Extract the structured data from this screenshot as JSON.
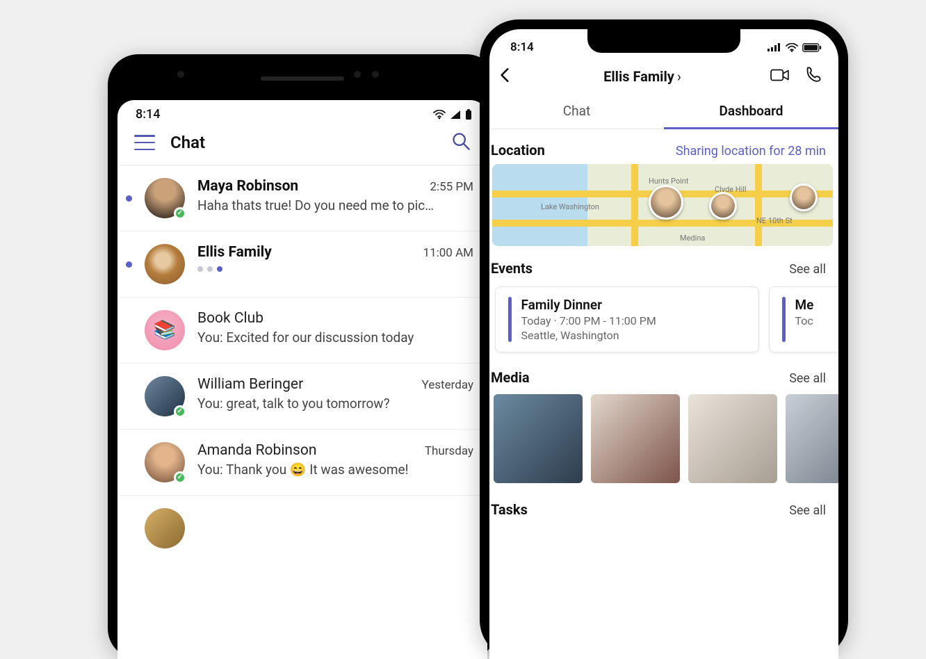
{
  "android": {
    "status_time": "8:14",
    "header_title": "Chat",
    "chats": [
      {
        "name": "Maya Robinson",
        "time": "2:55 PM",
        "preview": "Haha thats true! Do you need me to pic…",
        "unread": true,
        "presence": true,
        "avatar": "photo1"
      },
      {
        "name": "Ellis Family",
        "time": "11:00 AM",
        "preview": "",
        "typing": true,
        "unread": true,
        "presence": false,
        "avatar": "photo2"
      },
      {
        "name": "Book Club",
        "time": "",
        "preview": "You: Excited for our discussion today",
        "unread": false,
        "presence": false,
        "avatar": "pink"
      },
      {
        "name": "William Beringer",
        "time": "Yesterday",
        "preview": "You: great, talk to you tomorrow?",
        "unread": false,
        "presence": true,
        "avatar": "photo3"
      },
      {
        "name": "Amanda Robinson",
        "time": "Thursday",
        "preview": "You: Thank you 😄 It was awesome!",
        "unread": false,
        "presence": true,
        "avatar": "photo4"
      }
    ]
  },
  "iphone": {
    "status_time": "8:14",
    "conversation_title": "Ellis Family",
    "tabs": {
      "chat": "Chat",
      "dashboard": "Dashboard",
      "active": "dashboard"
    },
    "location": {
      "heading": "Location",
      "status": "Sharing location for 28 min",
      "map_labels": [
        "Lake Washington",
        "Hunts Point",
        "Clyde Hill",
        "Medina",
        "NE 10th St"
      ]
    },
    "events": {
      "heading": "Events",
      "see_all": "See all",
      "items": [
        {
          "title": "Family Dinner",
          "when": "Today · 7:00 PM - 11:00 PM",
          "where": "Seattle, Washington"
        },
        {
          "title": "Me",
          "when": "Toc",
          "where": ""
        }
      ]
    },
    "media": {
      "heading": "Media",
      "see_all": "See all",
      "count": 4
    },
    "tasks": {
      "heading": "Tasks",
      "see_all": "See all"
    }
  }
}
